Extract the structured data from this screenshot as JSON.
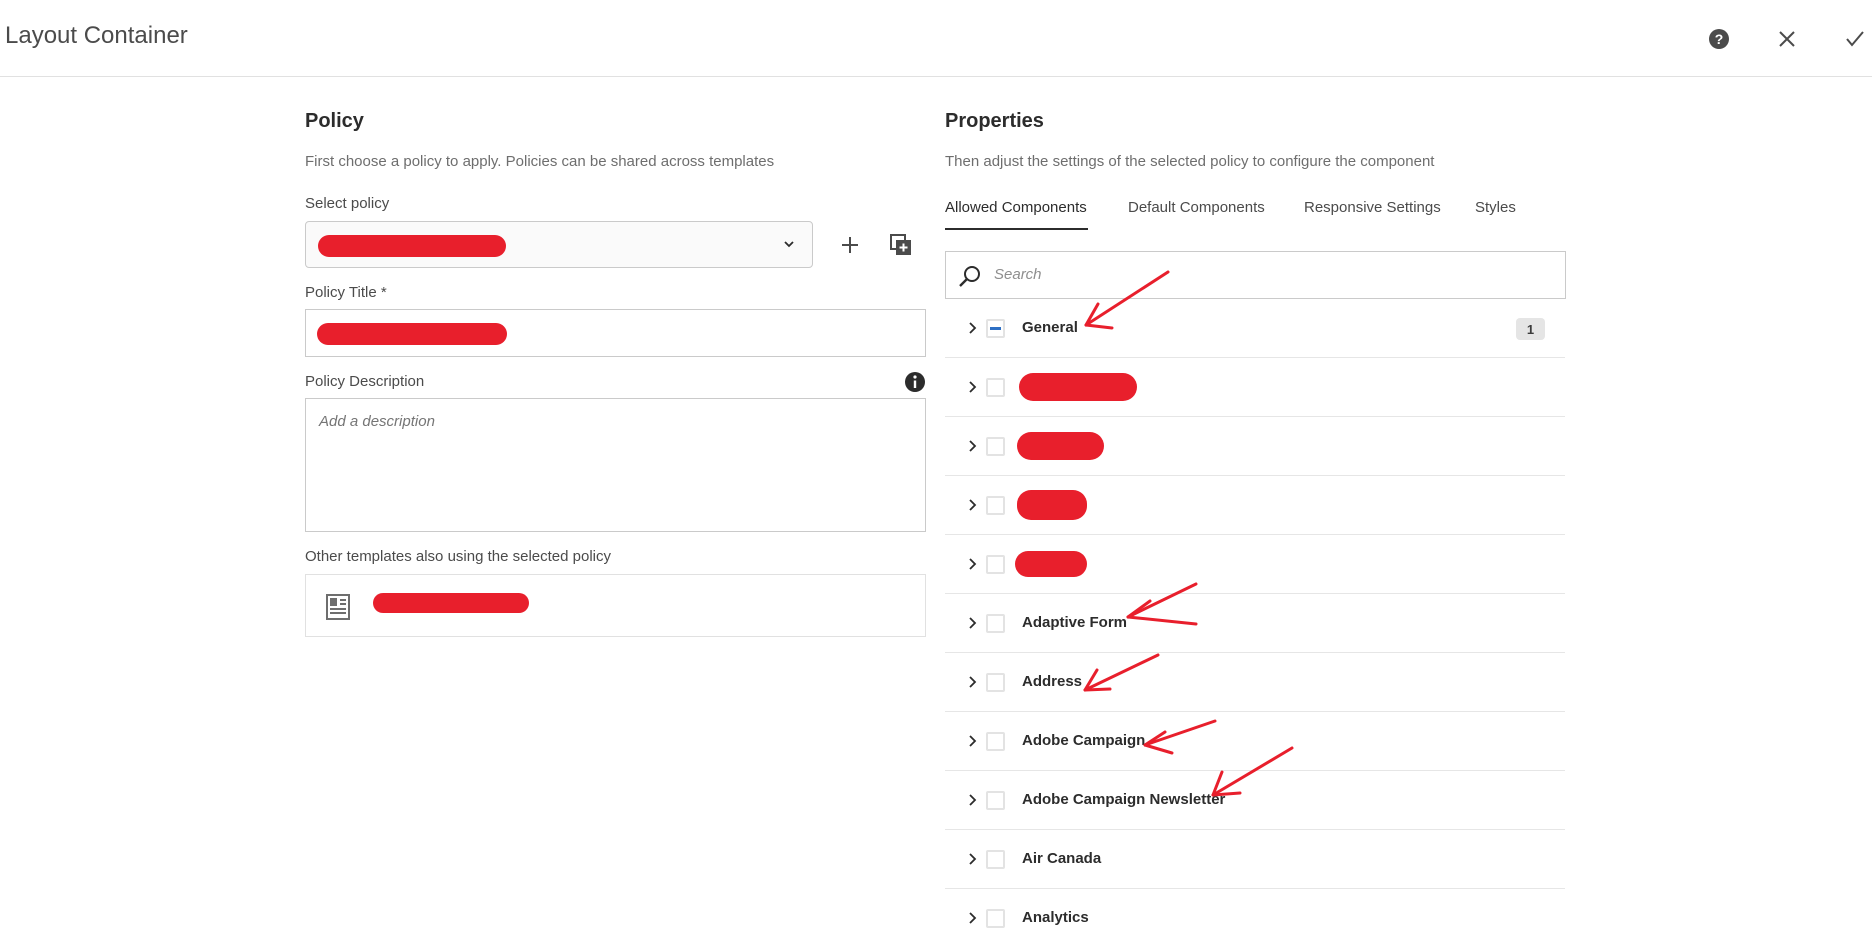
{
  "header": {
    "title": "Layout Container",
    "help_icon": "help-circle-icon",
    "close_icon": "close-icon",
    "done_icon": "checkmark-icon"
  },
  "policy": {
    "title": "Policy",
    "description": "First choose a policy to apply. Policies can be shared across templates",
    "select_label": "Select policy",
    "add_icon": "plus-icon",
    "duplicate_icon": "copy-add-icon",
    "policy_title_label": "Policy Title *",
    "policy_description_label": "Policy Description",
    "description_placeholder": "Add a description",
    "info_icon": "info-icon",
    "other_templates_label": "Other templates also using the selected policy",
    "template_icon": "page-template-icon"
  },
  "properties": {
    "title": "Properties",
    "description": "Then adjust the settings of the selected policy to configure the component",
    "tabs": [
      {
        "label": "Allowed Components",
        "active": true
      },
      {
        "label": "Default Components",
        "active": false
      },
      {
        "label": "Responsive Settings",
        "active": false
      },
      {
        "label": "Styles",
        "active": false
      }
    ],
    "search_placeholder": "Search",
    "rows": [
      {
        "label": "General",
        "state": "partial",
        "badge": "1"
      },
      {
        "label": "",
        "state": "unchecked",
        "redacted": true
      },
      {
        "label": "",
        "state": "unchecked",
        "redacted": true
      },
      {
        "label": "",
        "state": "unchecked",
        "redacted": true
      },
      {
        "label": "",
        "state": "unchecked",
        "redacted": true
      },
      {
        "label": "Adaptive Form",
        "state": "unchecked"
      },
      {
        "label": "Address",
        "state": "unchecked"
      },
      {
        "label": "Adobe Campaign",
        "state": "unchecked"
      },
      {
        "label": "Adobe Campaign Newsletter",
        "state": "unchecked"
      },
      {
        "label": "Air Canada",
        "state": "unchecked"
      },
      {
        "label": "Analytics",
        "state": "unchecked"
      }
    ]
  },
  "colors": {
    "redaction": "#e81f2c",
    "partial_check": "#2d6fc4",
    "text": "#2c2c2c",
    "muted": "#6e6e6e"
  }
}
